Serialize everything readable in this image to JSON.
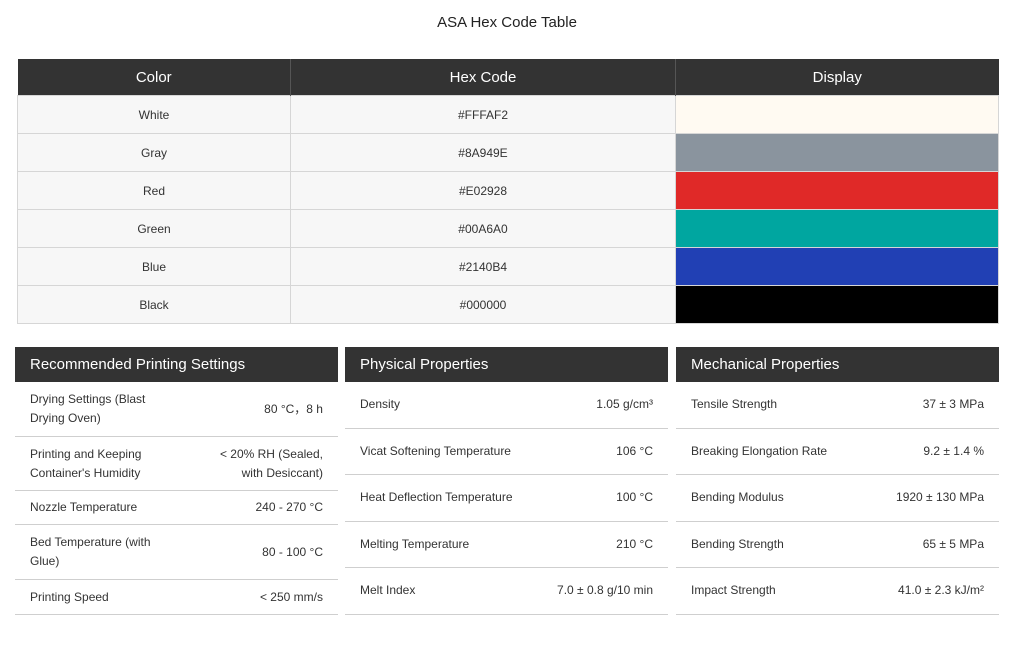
{
  "title": "ASA Hex Code Table",
  "hex_table": {
    "headers": [
      "Color",
      "Hex Code",
      "Display"
    ],
    "rows": [
      {
        "name": "White",
        "hex": "#FFFAF2",
        "swatch": "#FFFAF2"
      },
      {
        "name": "Gray",
        "hex": "#8A949E",
        "swatch": "#8A949E"
      },
      {
        "name": "Red",
        "hex": "#E02928",
        "swatch": "#E02928"
      },
      {
        "name": "Green",
        "hex": "#00A6A0",
        "swatch": "#00A6A0"
      },
      {
        "name": "Blue",
        "hex": "#2140B4",
        "swatch": "#2140B4"
      },
      {
        "name": "Black",
        "hex": "#000000",
        "swatch": "#000000"
      }
    ]
  },
  "printing": {
    "title": "Recommended Printing Settings",
    "rows": [
      {
        "label": "Drying Settings (Blast Drying Oven)",
        "value": "80 °C，8 h"
      },
      {
        "label": "Printing and Keeping Container's Humidity",
        "value": "< 20% RH (Sealed, with Desiccant)"
      },
      {
        "label": "Nozzle Temperature",
        "value": "240 - 270 °C"
      },
      {
        "label": "Bed Temperature (with Glue)",
        "value": "80 - 100 °C"
      },
      {
        "label": "Printing Speed",
        "value": "< 250 mm/s"
      }
    ]
  },
  "physical": {
    "title": "Physical Properties",
    "rows": [
      {
        "label": "Density",
        "value": "1.05 g/cm³"
      },
      {
        "label": "Vicat Softening Temperature",
        "value": "106 °C"
      },
      {
        "label": "Heat Deflection Temperature",
        "value": "100 °C"
      },
      {
        "label": "Melting Temperature",
        "value": "210 °C"
      },
      {
        "label": "Melt Index",
        "value": "7.0 ± 0.8 g/10 min"
      }
    ]
  },
  "mechanical": {
    "title": "Mechanical Properties",
    "rows": [
      {
        "label": "Tensile Strength",
        "value": "37 ± 3 MPa"
      },
      {
        "label": "Breaking Elongation Rate",
        "value": "9.2 ± 1.4 %"
      },
      {
        "label": "Bending Modulus",
        "value": "1920 ± 130 MPa"
      },
      {
        "label": "Bending Strength",
        "value": "65 ± 5 MPa"
      },
      {
        "label": "Impact Strength",
        "value": "41.0 ± 2.3 kJ/m²"
      }
    ]
  }
}
